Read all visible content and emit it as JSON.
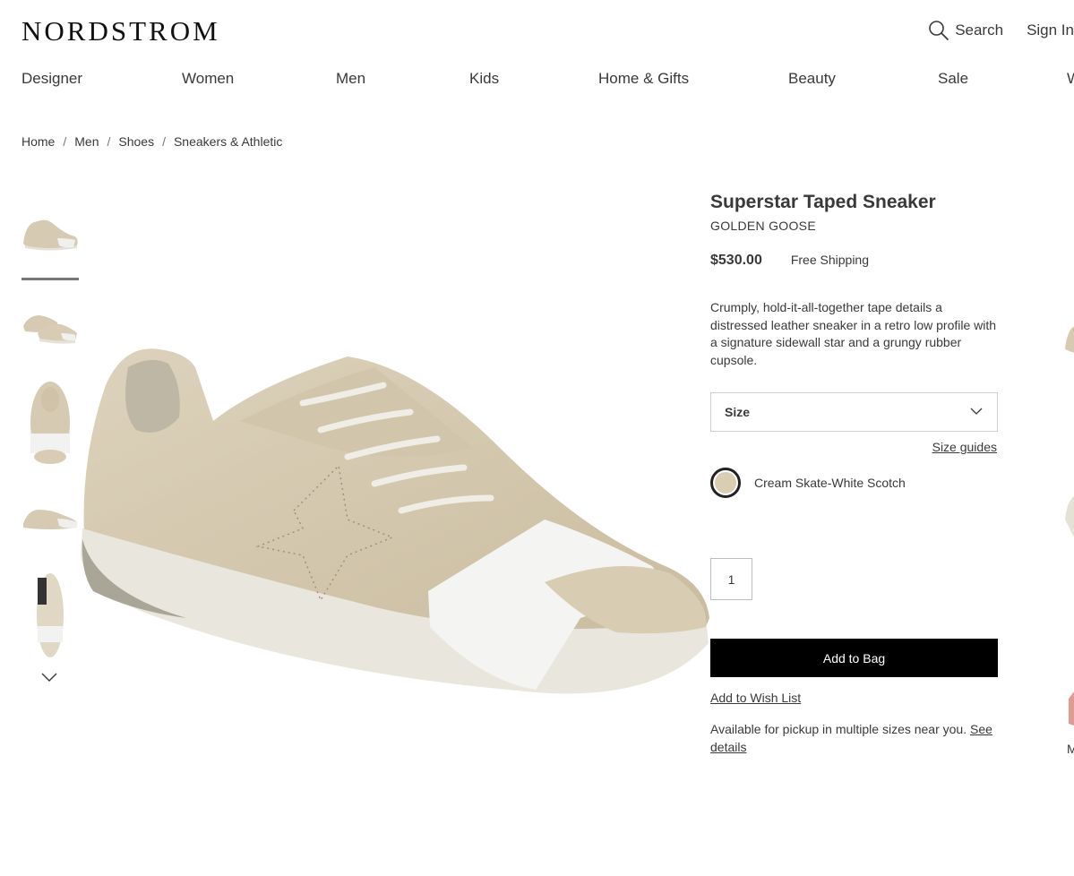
{
  "header": {
    "logo": "NORDSTROM",
    "search_label": "Search",
    "sign_in_label": "Sign In"
  },
  "nav": {
    "items": [
      "Designer",
      "Women",
      "Men",
      "Kids",
      "Home & Gifts",
      "Beauty",
      "Sale",
      "W"
    ]
  },
  "breadcrumb": {
    "items": [
      "Home",
      "Men",
      "Shoes",
      "Sneakers & Athletic"
    ],
    "separator": "/"
  },
  "gallery": {
    "thumbnail_icons": [
      "sneaker-side-view",
      "sneaker-pair-view",
      "sneaker-top-view",
      "sneaker-low-view",
      "sneaker-sole-view"
    ],
    "active_thumbnail": 1
  },
  "product": {
    "title": "Superstar Taped Sneaker",
    "brand": "GOLDEN GOOSE",
    "price": "$530.00",
    "shipping": "Free Shipping",
    "description": "Crumply, hold-it-all-together tape details a distressed leather sneaker in a retro low profile with a signature sidewall star and a grungy rubber cupsole.",
    "size_label": "Size",
    "size_guides": "Size guides",
    "color_name": "Cream Skate-White Scotch",
    "quantity": "1",
    "add_to_bag": "Add to Bag",
    "wish_list": "Add to Wish List",
    "pickup_text": "Available for pickup in multiple sizes near you.",
    "pickup_link": "See details"
  },
  "right_rail": {
    "partial_text": "M"
  },
  "colors": {
    "text": "#393939",
    "button_bg": "#000000",
    "swatch": "#d9cdb4"
  }
}
